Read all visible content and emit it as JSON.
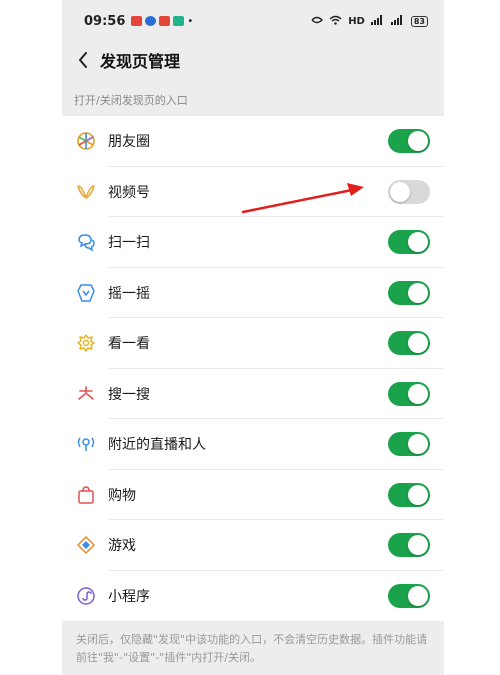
{
  "status_bar": {
    "time": "09:56",
    "network_label": "HD",
    "battery": "83"
  },
  "header": {
    "title": "发现页管理"
  },
  "section": {
    "label": "打开/关闭发现页的入口"
  },
  "items": [
    {
      "label": "朋友圈",
      "icon": "moments-icon",
      "enabled": true
    },
    {
      "label": "视频号",
      "icon": "channels-icon",
      "enabled": false
    },
    {
      "label": "扫一扫",
      "icon": "scan-icon",
      "enabled": true
    },
    {
      "label": "摇一摇",
      "icon": "shake-icon",
      "enabled": true
    },
    {
      "label": "看一看",
      "icon": "top-stories-icon",
      "enabled": true
    },
    {
      "label": "搜一搜",
      "icon": "search-icon",
      "enabled": true
    },
    {
      "label": "附近的直播和人",
      "icon": "nearby-icon",
      "enabled": true
    },
    {
      "label": "购物",
      "icon": "shopping-bag-icon",
      "enabled": true
    },
    {
      "label": "游戏",
      "icon": "games-icon",
      "enabled": true
    },
    {
      "label": "小程序",
      "icon": "mini-programs-icon",
      "enabled": true
    }
  ],
  "footer": {
    "note": "关闭后，仅隐藏\"发现\"中该功能的入口，不会清空历史数据。插件功能请前往\"我\"-\"设置\"-\"插件\"内打开/关闭。"
  },
  "colors": {
    "toggle_on": "#1aa34a",
    "toggle_off": "#d9d9d9",
    "annotation_arrow": "#e02020",
    "background": "#ededed"
  }
}
